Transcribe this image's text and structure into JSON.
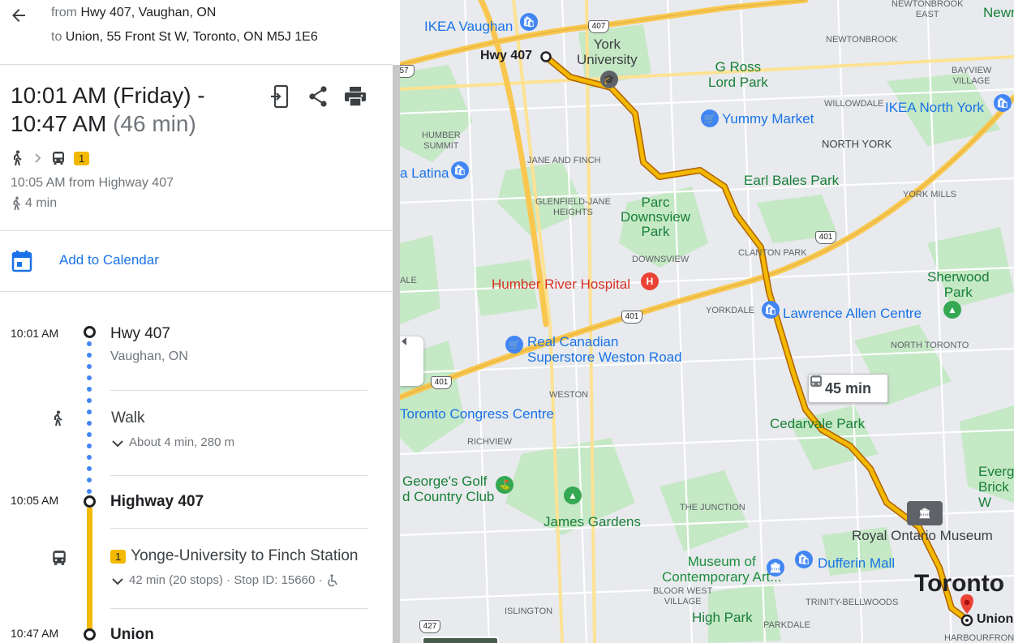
{
  "header": {
    "from_prefix": "from",
    "from_value": "Hwy 407, Vaughan, ON",
    "to_prefix": "to",
    "to_value": "Union, 55 Front St W, Toronto, ON M5J 1E6"
  },
  "summary": {
    "line1": "10:01 AM (Friday) -",
    "line2_time": "10:47 AM ",
    "duration": "(46 min)",
    "line_badge": "1",
    "depart_text": "10:05 AM from Highway 407",
    "walk_text": "4 min"
  },
  "calendar": {
    "label": "Add to Calendar"
  },
  "steps": {
    "start_time": "10:01 AM",
    "start_name": "Hwy 407",
    "start_sub": "Vaughan, ON",
    "walk_title": "Walk",
    "walk_detail": "About 4 min, 280 m",
    "board_time": "10:05 AM",
    "board_name": "Highway 407",
    "bus_badge": "1",
    "bus_title": "Yonge-University to Finch Station",
    "bus_detail": "42 min (20 stops) · Stop ID: 15660 ·",
    "end_time": "10:47 AM",
    "end_name": "Union"
  },
  "map": {
    "transit_chip": "45 min",
    "city_label": "Toronto",
    "places": {
      "hwy407": "Hwy 407",
      "union": "Union",
      "york_university": "York\nUniversity",
      "ikea_vaughan": "IKEA Vaughan",
      "g_ross_lord": "G Ross\nLord Park",
      "yummy_market": "Yummy Market",
      "ikea_north_york": "IKEA North York",
      "north_york": "NORTH YORK",
      "earl_bales": "Earl Bales Park",
      "york_mills": "YORK MILLS",
      "latina": "a Latina",
      "jane_finch": "JANE AND FINCH",
      "humber_summit": "HUMBER\nSUMMIT",
      "glenfield": "GLENFIELD-JANE\nHEIGHTS",
      "parc_downsview": "Parc\nDownsview\nPark",
      "downsview": "DOWNSVIEW",
      "clanton": "CLANTON PARK",
      "humber_river": "Humber River Hospital",
      "yorkdale": "YORKDALE",
      "lawrence_allen": "Lawrence Allen Centre",
      "sherwood": "Sherwood\nPark",
      "north_toronto": "NORTH TORONTO",
      "real_canadian": "Real Canadian\nSuperstore Weston Road",
      "weston": "WESTON",
      "toronto_congress": "Toronto Congress Centre",
      "cedarvale": "Cedarvale Park",
      "richview": "RICHVIEW",
      "georges_golf": "George's Golf\nd Country Club",
      "james_gardens": "James Gardens",
      "the_junction": "THE JUNCTION",
      "royal_ontario": "Royal Ontario Museum",
      "museum_contemporary": "Museum of\nContemporary Art...",
      "dufferin_mall": "Dufferin Mall",
      "bloor_west": "BLOOR WEST\nVILLAGE",
      "trinity": "TRINITY-BELLWOODS",
      "islington": "ISLINGTON",
      "high_park": "High Park",
      "parkdale": "PARKDALE",
      "harbourfront": "HARBOURFRONT",
      "newtonbrook_east": "NEWTONBROOK\nEAST",
      "newtonbrook": "NEWTONBROOK",
      "willowdale": "WILLOWDALE",
      "bayview_village": "BAYVIEW\nVILLAGE",
      "newmarket_cut": "Newn",
      "evergreen_cut": "Everg\nBrick W",
      "ale_cut": "ALE",
      "hwy_407_shield": "407",
      "hwy_401_shield": "401",
      "hwy_427_shield": "427",
      "hwy_57_cut": "57"
    }
  },
  "colors": {
    "route": "#f2b900",
    "link": "#1a73e8",
    "walk_dots": "#4285f4",
    "pin_red": "#ea4335"
  }
}
